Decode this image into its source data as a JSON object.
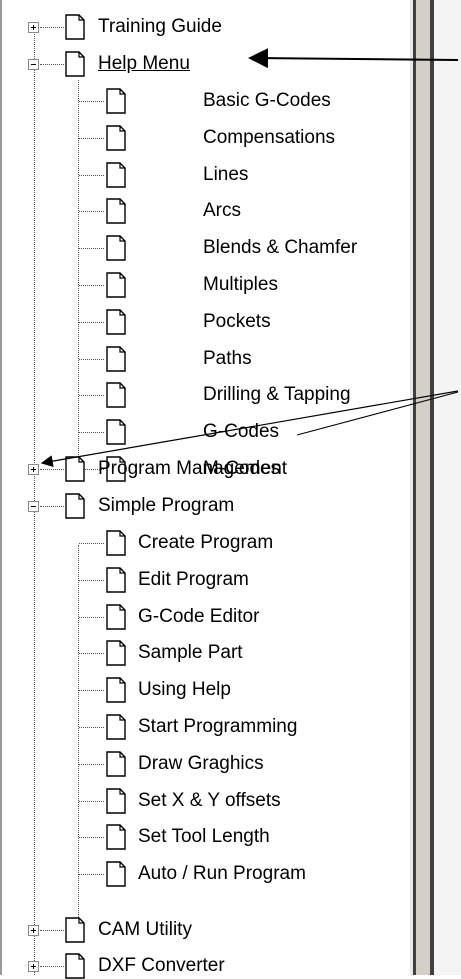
{
  "tree": {
    "top_nodes": [
      {
        "label": "Training Guide",
        "expander": "plus",
        "selected": false
      },
      {
        "label": "Help Menu",
        "expander": "minus",
        "selected": true,
        "children": [
          "Basic G-Codes",
          "Compensations",
          "Lines",
          "Arcs",
          "Blends & Chamfer",
          "Multiples",
          "Pockets",
          "Paths",
          "Drilling & Tapping",
          "G-Codes",
          "M-Codes"
        ]
      },
      {
        "label": "Program Management",
        "expander": "plus",
        "selected": false
      },
      {
        "label": "Simple Program",
        "expander": "minus",
        "selected": false,
        "children": [
          "Create Program",
          "Edit Program",
          "G-Code Editor",
          "Sample Part",
          "Using Help",
          "Start Programming",
          "Draw Graghics",
          "Set X & Y offsets",
          "Set Tool Length",
          "Auto / Run Program"
        ]
      },
      {
        "label": "CAM Utility",
        "expander": "plus",
        "selected": false
      },
      {
        "label": "DXF Converter",
        "expander": "plus",
        "selected": false
      }
    ]
  },
  "icons": {
    "node": "page-icon",
    "expand": "plus-icon",
    "collapse": "minus-icon"
  },
  "colors": {
    "background": "#ffffff",
    "splitter_dark": "#404040",
    "splitter_light": "#d4d0c8",
    "arrow": "#000000"
  }
}
